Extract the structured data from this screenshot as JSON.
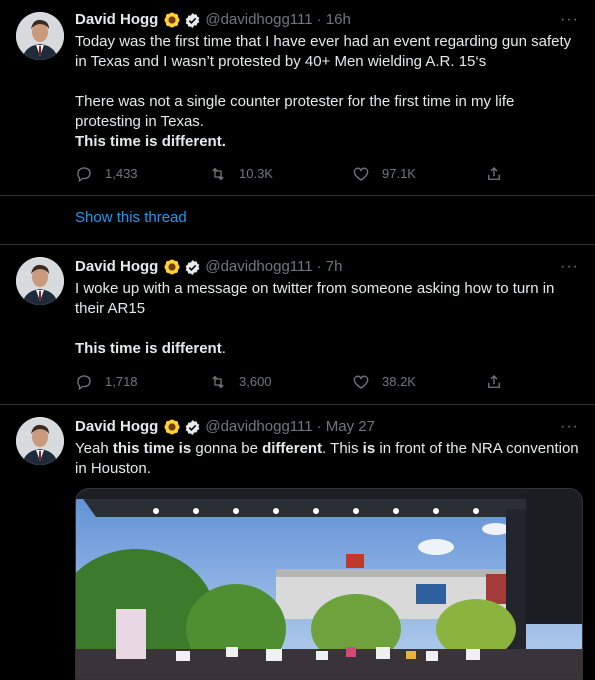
{
  "tweets": [
    {
      "name": "David Hogg",
      "handle": "@davidhogg111",
      "time": "· 16h",
      "more": "···",
      "lines": [
        "Today was the first time that I have ever had an event regarding gun safety",
        "in Texas and I wasn’t protested by 40+ Men wielding A.R. 15‘s",
        "There was not a single counter protester for the first time in my life",
        "protesting in Texas."
      ],
      "bold_line": "This time is different.",
      "replies": "1,433",
      "retweets": "10.3K",
      "likes": "97.1K"
    },
    {
      "name": "David Hogg",
      "handle": "@davidhogg111",
      "time": "· 7h",
      "more": "···",
      "lines": [
        "I woke up with a message on twitter from someone asking how to turn in",
        "their AR15"
      ],
      "bold_part": "This time is different",
      "after_bold": ".",
      "replies": "1,718",
      "retweets": "3,600",
      "likes": "38.2K"
    },
    {
      "name": "David Hogg",
      "handle": "@davidhogg111",
      "time": "· May 27",
      "more": "···",
      "seg1": "Yeah ",
      "seg2": "this time is",
      "seg3": " gonna be ",
      "seg4": "different",
      "seg5": ". This ",
      "seg6": "is",
      "seg7": " in front of the NRA convention",
      "line2": "in Houston."
    }
  ],
  "thread_link": "Show this thread",
  "colors": {
    "background": "#000000",
    "text": "#e7e9ea",
    "muted": "#71767b",
    "link": "#1d9bf0",
    "divider": "#2f3336"
  }
}
